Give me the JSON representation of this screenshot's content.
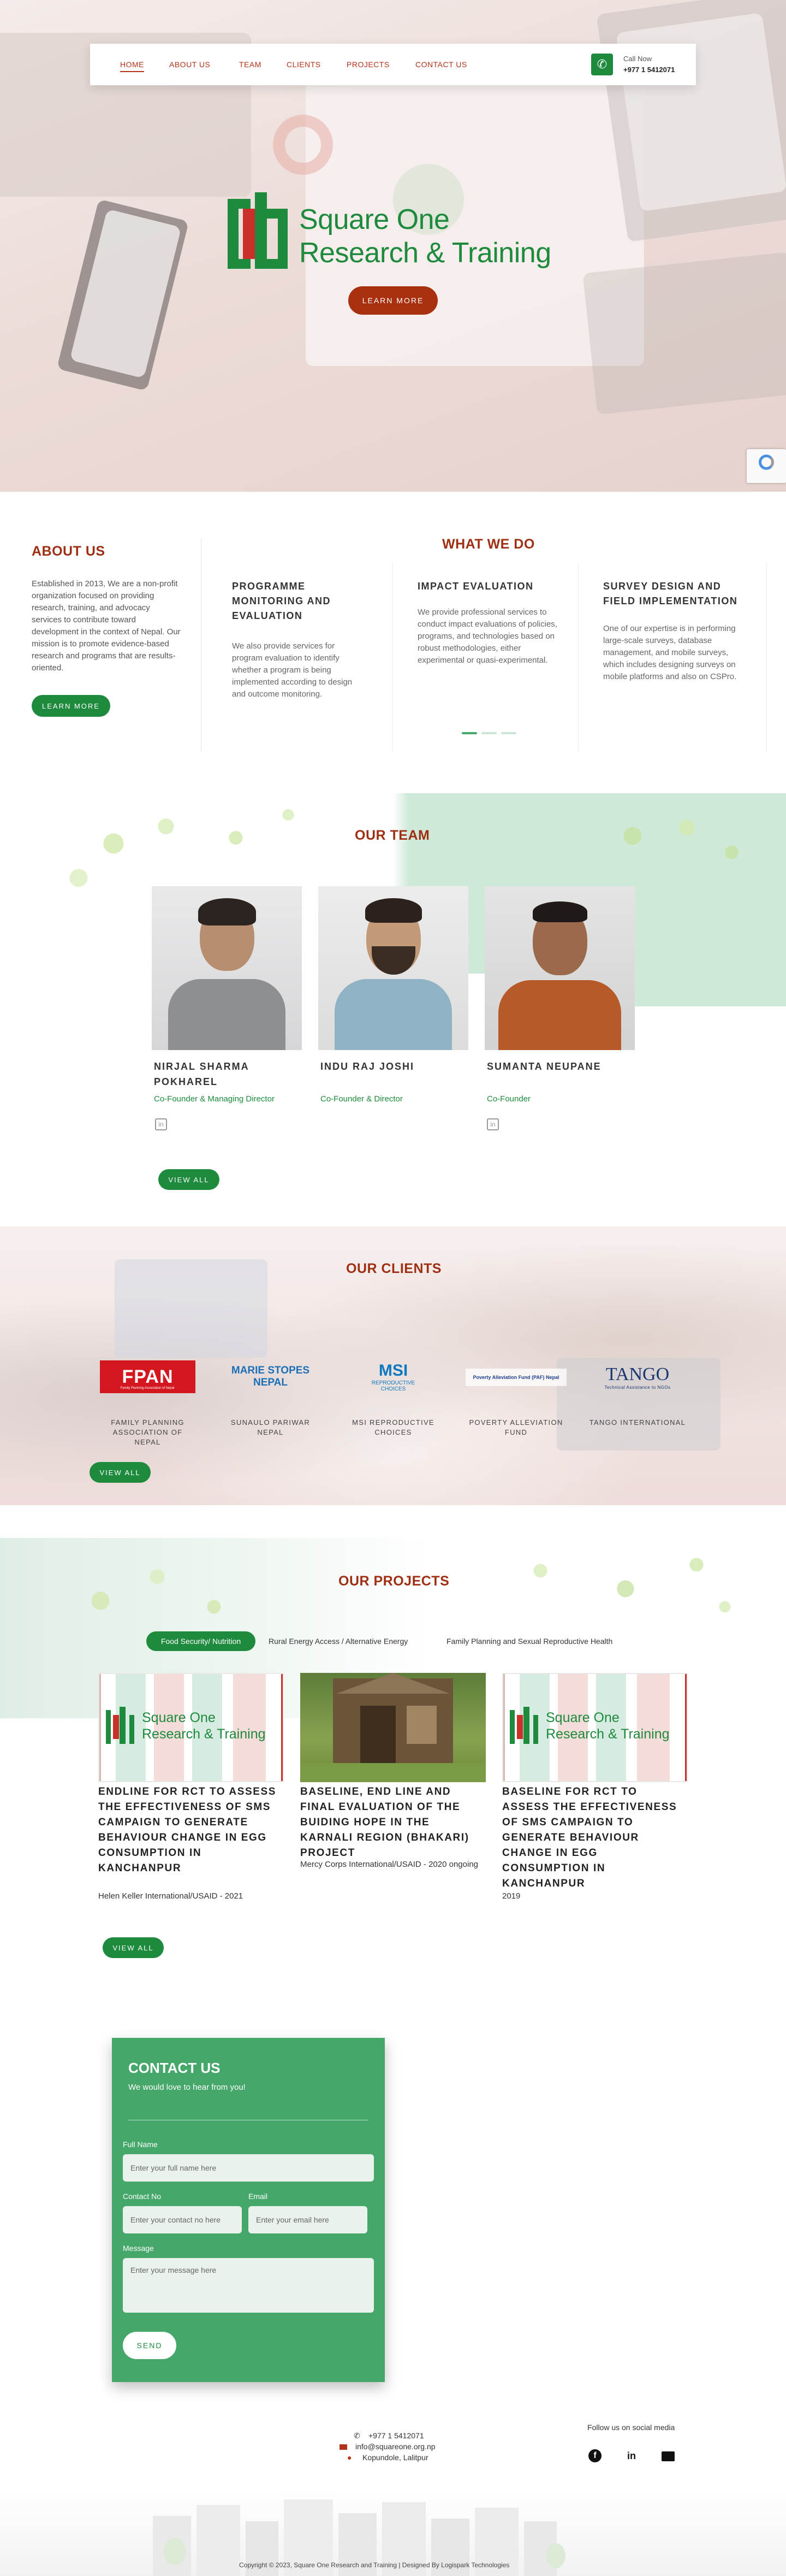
{
  "header": {
    "nav": [
      "HOME",
      "ABOUT US",
      "TEAM",
      "CLIENTS",
      "PROJECTS",
      "CONTACT US"
    ],
    "call_label": "Call Now",
    "call_number": "+977 1 5412071"
  },
  "hero": {
    "brand_line1": "Square One",
    "brand_line2": "Research & Training",
    "cta": "LEARN MORE"
  },
  "about": {
    "title": "ABOUT US",
    "text": "Established in 2013, We are a non-profit organization focused on providing research, training, and advocacy services to contribute toward development in the context of Nepal. Our mission is to promote evidence-based research and programs that are results-oriented.",
    "cta": "LEARN MORE"
  },
  "services": {
    "title": "WHAT WE DO",
    "items": [
      {
        "title": "PROGRAMME MONITORING AND EVALUATION",
        "text": "We also provide services for program evaluation to identify whether a program is being implemented according to design and outcome monitoring."
      },
      {
        "title": "IMPACT EVALUATION",
        "text": "We provide professional services to conduct impact evaluations of policies, programs, and technologies based on robust methodologies, either experimental or quasi-experimental."
      },
      {
        "title": "SURVEY DESIGN AND FIELD IMPLEMENTATION",
        "text": "One of our expertise is in performing large-scale surveys, database management, and mobile surveys, which includes designing surveys on mobile platforms and also on CSPro."
      }
    ]
  },
  "team": {
    "title": "OUR TEAM",
    "members": [
      {
        "name": "NIRJAL SHARMA POKHAREL",
        "role": "Co-Founder & Managing Director"
      },
      {
        "name": "INDU RAJ JOSHI",
        "role": "Co-Founder & Director"
      },
      {
        "name": "SUMANTA NEUPANE",
        "role": "Co-Founder"
      }
    ],
    "cta": "VIEW ALL"
  },
  "clients": {
    "title": "OUR CLIENTS",
    "items": [
      {
        "name": "FAMILY PLANNING ASSOCIATION OF NEPAL",
        "logo": "FPAN",
        "logo_sub": "Family Planning Association of Nepal"
      },
      {
        "name": "SUNAULO PARIWAR NEPAL",
        "logo": "MARIE STOPES",
        "logo_sub": "NEPAL"
      },
      {
        "name": "MSI REPRODUCTIVE CHOICES",
        "logo": "MSI",
        "logo_sub": "REPRODUCTIVE CHOICES"
      },
      {
        "name": "POVERTY ALLEVIATION FUND",
        "logo": "Poverty Alleviation Fund (PAF) Nepal",
        "logo_sub": ""
      },
      {
        "name": "TANGO INTERNATIONAL",
        "logo": "TANGO",
        "logo_sub": "Technical Assistance to NGOs"
      }
    ],
    "cta": "VIEW ALL"
  },
  "projects": {
    "title": "OUR PROJECTS",
    "tabs": [
      "Food Security/ Nutrition",
      "Rural Energy Access / Alternative Energy",
      "Family Planning and Sexual Reproductive Health"
    ],
    "items": [
      {
        "title": "ENDLINE FOR RCT TO ASSESS THE EFFECTIVENESS OF SMS CAMPAIGN TO GENERATE BEHAVIOUR CHANGE IN EGG CONSUMPTION IN KANCHANPUR",
        "meta": "Helen Keller International/USAID - 2021"
      },
      {
        "title": "BASELINE, END LINE AND FINAL EVALUATION OF THE BUIDING HOPE IN THE KARNALI REGION (BHAKARI) PROJECT",
        "meta": "Mercy Corps International/USAID - 2020 ongoing"
      },
      {
        "title": "BASELINE FOR RCT TO ASSESS THE EFFECTIVENESS OF SMS CAMPAIGN TO GENERATE BEHAVIOUR CHANGE IN EGG CONSUMPTION IN KANCHANPUR",
        "meta": "2019"
      }
    ],
    "card_brand_1": "Square One",
    "card_brand_2": "Research & Training",
    "cta": "VIEW ALL"
  },
  "contact": {
    "title": "CONTACT US",
    "subtitle": "We would love to hear from you!",
    "name_label": "Full Name",
    "name_placeholder": "Enter your full name here",
    "phone_label": "Contact No",
    "phone_placeholder": "Enter your contact no here",
    "email_label": "Email",
    "email_placeholder": "Enter your email here",
    "message_label": "Message",
    "message_placeholder": "Enter your message here",
    "send": "SEND"
  },
  "footer": {
    "phone": "+977 1 5412071",
    "email": "info@squareone.org.np",
    "address": "Kopundole, Lalitpur",
    "social_label": "Follow us on social media",
    "copyright": "Copyright © 2023, Square One Research and Training | Designed By Logispark Technologies"
  },
  "colors": {
    "brand_green": "#1e8a3e",
    "brand_red": "#a8300f",
    "contact_bg": "#45a86a"
  }
}
